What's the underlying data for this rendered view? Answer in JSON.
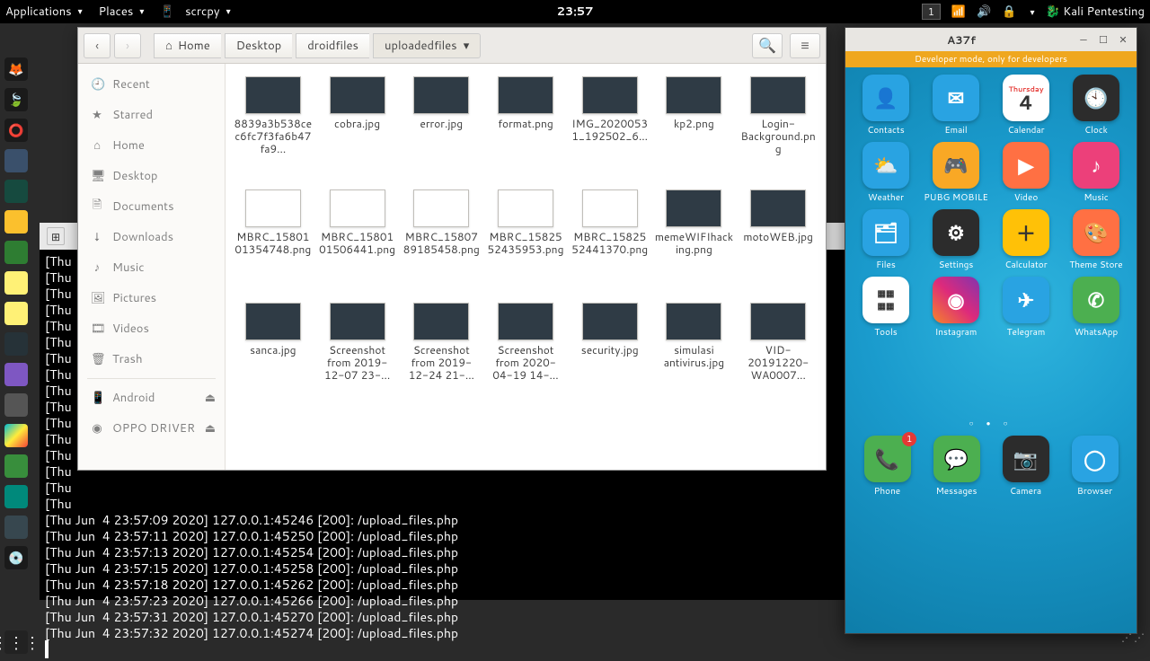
{
  "topbar": {
    "applications": "Applications",
    "places": "Places",
    "active_app": "scrcpy",
    "clock": "23:57",
    "workspace": "1",
    "user": "Kali Pentesting"
  },
  "filemanager": {
    "breadcrumbs": [
      "Home",
      "Desktop",
      "droidfiles",
      "uploadedfiles"
    ],
    "sidebar": {
      "recent": "Recent",
      "starred": "Starred",
      "home": "Home",
      "desktop": "Desktop",
      "documents": "Documents",
      "downloads": "Downloads",
      "music": "Music",
      "pictures": "Pictures",
      "videos": "Videos",
      "trash": "Trash",
      "android": "Android",
      "oppo": "OPPO DRIVER"
    },
    "files": [
      {
        "name": "8839a3b538cec6fc7f3fa6b47fa9...",
        "type": "img"
      },
      {
        "name": "cobra.jpg",
        "type": "img"
      },
      {
        "name": "error.jpg",
        "type": "img"
      },
      {
        "name": "format.png",
        "type": "img"
      },
      {
        "name": "IMG_20200531_192502_6...",
        "type": "img"
      },
      {
        "name": "kp2.png",
        "type": "img"
      },
      {
        "name": "Login-Background.png",
        "type": "img"
      },
      {
        "name": "MBRC_1580101354748.png",
        "type": "doc"
      },
      {
        "name": "MBRC_1580101506441.png",
        "type": "doc"
      },
      {
        "name": "MBRC_1580789185458.png",
        "type": "doc"
      },
      {
        "name": "MBRC_1582552435953.png",
        "type": "doc"
      },
      {
        "name": "MBRC_1582552441370.png",
        "type": "doc"
      },
      {
        "name": "memeWIFIhacking.png",
        "type": "img"
      },
      {
        "name": "motoWEB.jpg",
        "type": "img"
      },
      {
        "name": "sanca.jpg",
        "type": "img"
      },
      {
        "name": "Screenshot from 2019-12-07 23-...",
        "type": "img"
      },
      {
        "name": "Screenshot from 2019-12-24 21-...",
        "type": "img"
      },
      {
        "name": "Screenshot from 2020-04-19 14-...",
        "type": "img"
      },
      {
        "name": "security.jpg",
        "type": "img"
      },
      {
        "name": "simulasi antivirus.jpg",
        "type": "img"
      },
      {
        "name": "VID-20191220-WA0007...",
        "type": "img"
      }
    ]
  },
  "terminal": {
    "lines": [
      "[Thu",
      "[Thu",
      "[Thu",
      "[Thu",
      "[Thu",
      "[Thu",
      "[Thu",
      "[Thu",
      "[Thu",
      "[Thu",
      "[Thu",
      "[Thu",
      "[Thu",
      "[Thu",
      "[Thu",
      "[Thu",
      "[Thu Jun  4 23:57:09 2020] 127.0.0.1:45246 [200]: /upload_files.php",
      "[Thu Jun  4 23:57:11 2020] 127.0.0.1:45250 [200]: /upload_files.php",
      "[Thu Jun  4 23:57:13 2020] 127.0.0.1:45254 [200]: /upload_files.php",
      "[Thu Jun  4 23:57:15 2020] 127.0.0.1:45258 [200]: /upload_files.php",
      "[Thu Jun  4 23:57:18 2020] 127.0.0.1:45262 [200]: /upload_files.php",
      "[Thu Jun  4 23:57:23 2020] 127.0.0.1:45266 [200]: /upload_files.php",
      "[Thu Jun  4 23:57:31 2020] 127.0.0.1:45270 [200]: /upload_files.php",
      "[Thu Jun  4 23:57:32 2020] 127.0.0.1:45274 [200]: /upload_files.php"
    ]
  },
  "phone": {
    "title": "A37f",
    "dev_banner": "Developer mode, only for developers",
    "calendar_day": "Thursday",
    "calendar_num": "4",
    "badge_phone": "1",
    "apps": {
      "contacts": "Contacts",
      "email": "Email",
      "calendar": "Calendar",
      "clock": "Clock",
      "weather": "Weather",
      "pubg": "PUBG MOBILE",
      "video": "Video",
      "music": "Music",
      "files": "Files",
      "settings": "Settings",
      "calculator": "Calculator",
      "theme": "Theme Store",
      "tools": "Tools",
      "instagram": "Instagram",
      "telegram": "Telegram",
      "whatsapp": "WhatsApp",
      "phone": "Phone",
      "messages": "Messages",
      "camera": "Camera",
      "browser": "Browser"
    }
  }
}
